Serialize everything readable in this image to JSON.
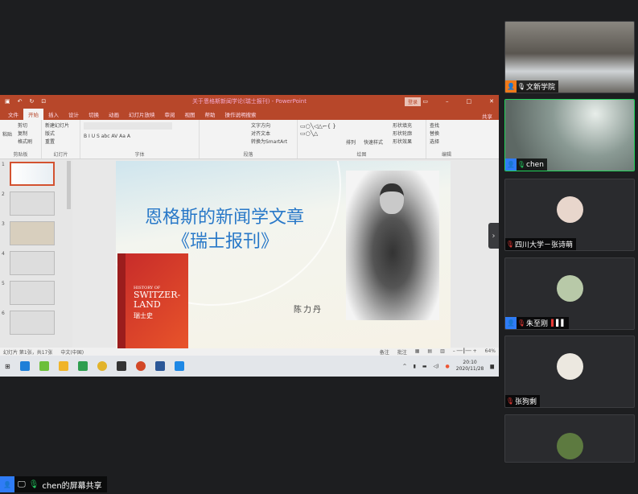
{
  "ppt": {
    "title": "关于恩格斯新闻学论(瑞士报刊) - PowerPoint",
    "login": "登录",
    "tabs": [
      "文件",
      "开始",
      "插入",
      "设计",
      "切换",
      "动画",
      "幻灯片放映",
      "审阅",
      "视图",
      "帮助",
      "操作说明搜索"
    ],
    "active_tab": "开始",
    "share": "共享",
    "groups": [
      {
        "label": "剪贴板",
        "items": [
          "粘贴",
          "剪切",
          "复制",
          "格式刷"
        ]
      },
      {
        "label": "幻灯片",
        "items": [
          "新建幻灯片",
          "版式",
          "重置",
          "节"
        ]
      },
      {
        "label": "字体",
        "items": [
          "B I U S abc AV Aa A"
        ]
      },
      {
        "label": "段落",
        "items": [
          "文字方向",
          "对齐文本",
          "转换为SmartArt"
        ]
      },
      {
        "label": "绘图",
        "items": [
          "排列",
          "快速样式",
          "形状填充",
          "形状轮廓",
          "形状效果"
        ]
      },
      {
        "label": "编辑",
        "items": [
          "查找",
          "替换",
          "选择"
        ]
      }
    ],
    "thumb_numbers": [
      "1",
      "2",
      "3",
      "4",
      "5",
      "6"
    ],
    "slide": {
      "title_line1": "恩格斯的新闻学文章",
      "title_line2": "《瑞士报刊》",
      "author": "陈力丹",
      "book_line1": "HISTORY OF",
      "book_line2": "SWITZER-",
      "book_line3": "LAND",
      "book_cn": "瑞士史"
    },
    "status": {
      "slide_info": "幻灯片 第1张，共17张",
      "lang": "中文(中国)",
      "notes": "备注",
      "comments": "批注",
      "zoom": "64%"
    },
    "taskbar": {
      "time": "20:10",
      "date": "2020/11/28"
    }
  },
  "participants": [
    {
      "name": "文新学院",
      "muted": false,
      "badge_color": "#f07a1a",
      "video": true
    },
    {
      "name": "chen",
      "muted": false,
      "badge_color": "#2f7cf6",
      "video": true,
      "speaking": true
    },
    {
      "name": "四川大学－张诗萌",
      "muted": true
    },
    {
      "name": "朱至刚",
      "muted": true,
      "badge_color": "#2f7cf6",
      "signal": true
    },
    {
      "name": "张狗剩",
      "muted": true
    },
    {
      "name": "",
      "muted": true
    }
  ],
  "share_label": "chen的屏幕共享",
  "colors": {
    "ppt_accent": "#b7472a",
    "speaking_border": "#22d35a",
    "mic_on": "#22c55e",
    "mic_off": "#e53935"
  }
}
